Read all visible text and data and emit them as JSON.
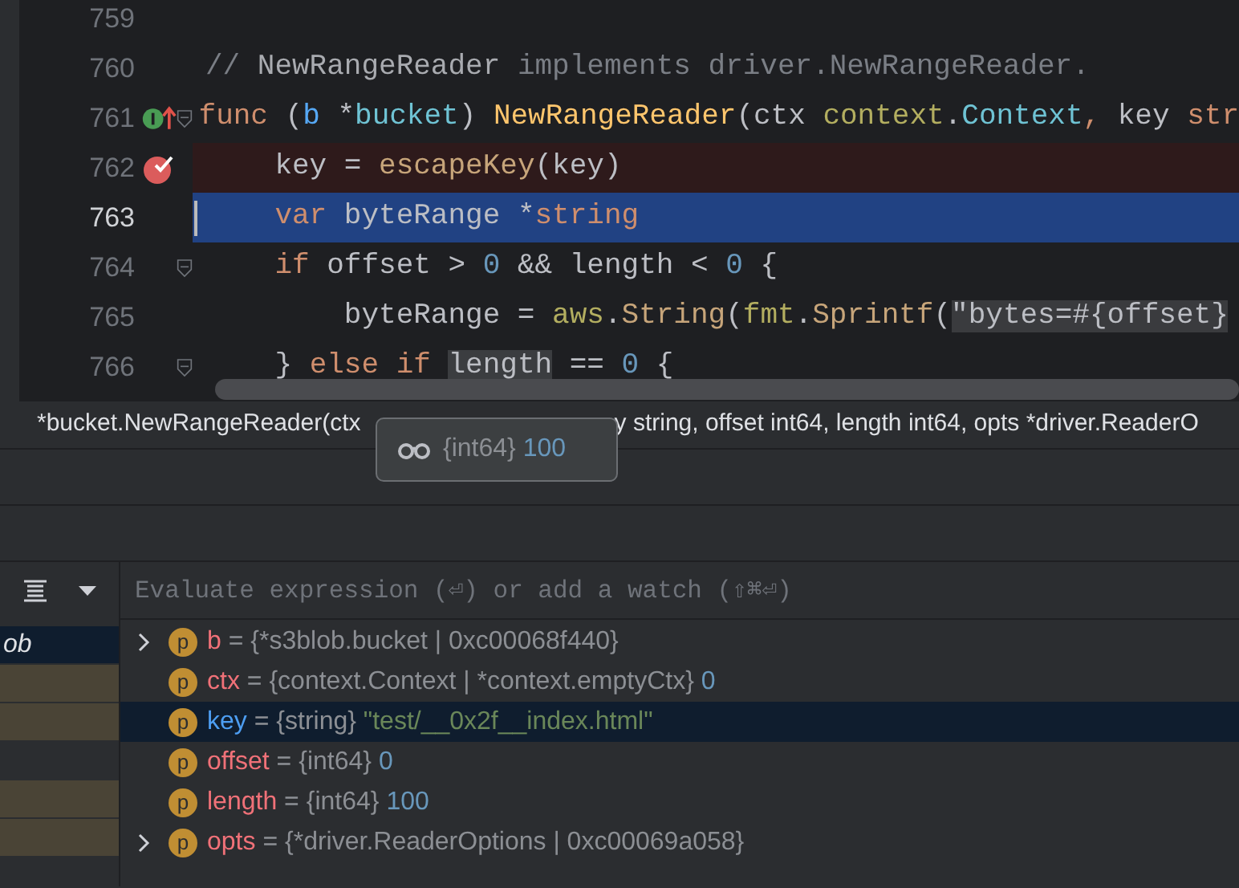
{
  "editor": {
    "lines": [
      {
        "number": "759",
        "breakpoint": false,
        "current": false,
        "implements": false,
        "fold": false
      },
      {
        "number": "760",
        "breakpoint": false,
        "current": false,
        "implements": false,
        "fold": false,
        "tokens": [
          {
            "text": "// ",
            "kind": "comment"
          },
          {
            "text": "NewRangeReader",
            "kind": "comment_ref"
          },
          {
            "text": " implements driver.NewRangeReader.",
            "kind": "comment"
          }
        ]
      },
      {
        "number": "761",
        "breakpoint": false,
        "current": false,
        "implements": true,
        "fold": true,
        "tokens": [
          {
            "text": "func",
            "kind": "kw"
          },
          {
            "text": " (",
            "kind": "plain"
          },
          {
            "text": "b",
            "kind": "param"
          },
          {
            "text": " *",
            "kind": "plain"
          },
          {
            "text": "bucket",
            "kind": "type"
          },
          {
            "text": ") ",
            "kind": "plain"
          },
          {
            "text": "NewRangeReader",
            "kind": "fn"
          },
          {
            "text": "(ctx ",
            "kind": "plain"
          },
          {
            "text": "context",
            "kind": "pkg"
          },
          {
            "text": ".",
            "kind": "plain"
          },
          {
            "text": "Context",
            "kind": "type"
          },
          {
            "text": ", ",
            "kind": "kw"
          },
          {
            "text": "key ",
            "kind": "plain"
          },
          {
            "text": "str",
            "kind": "kw"
          }
        ]
      },
      {
        "number": "762",
        "breakpoint": true,
        "current": false,
        "implements": false,
        "fold": false,
        "tokens": [
          {
            "text": "    key = ",
            "kind": "plain"
          },
          {
            "text": "escapeKey",
            "kind": "call"
          },
          {
            "text": "(key)",
            "kind": "plain"
          }
        ]
      },
      {
        "number": "763",
        "breakpoint": false,
        "current": true,
        "implements": false,
        "fold": false,
        "tokens": [
          {
            "text": "    var",
            "kind": "kw"
          },
          {
            "text": " byteRange *",
            "kind": "plain"
          },
          {
            "text": "string",
            "kind": "kw"
          }
        ]
      },
      {
        "number": "764",
        "breakpoint": false,
        "current": false,
        "implements": false,
        "fold": true,
        "tokens": [
          {
            "text": "    if",
            "kind": "kw"
          },
          {
            "text": " offset > ",
            "kind": "plain"
          },
          {
            "text": "0",
            "kind": "num"
          },
          {
            "text": " && length < ",
            "kind": "plain"
          },
          {
            "text": "0",
            "kind": "num"
          },
          {
            "text": " {",
            "kind": "plain"
          }
        ]
      },
      {
        "number": "765",
        "breakpoint": false,
        "current": false,
        "implements": false,
        "fold": false,
        "tokens": [
          {
            "text": "        byteRange = ",
            "kind": "plain"
          },
          {
            "text": "aws",
            "kind": "pkg"
          },
          {
            "text": ".",
            "kind": "plain"
          },
          {
            "text": "String",
            "kind": "call"
          },
          {
            "text": "(",
            "kind": "plain"
          },
          {
            "text": "fmt",
            "kind": "pkg"
          },
          {
            "text": ".",
            "kind": "plain"
          },
          {
            "text": "Sprintf",
            "kind": "call"
          },
          {
            "text": "(",
            "kind": "plain"
          },
          {
            "text": "\"bytes=#{offset}",
            "kind": "inlay"
          }
        ]
      },
      {
        "number": "766",
        "breakpoint": false,
        "current": false,
        "implements": false,
        "fold": true,
        "tokens": [
          {
            "text": "    } ",
            "kind": "plain"
          },
          {
            "text": "else if ",
            "kind": "kw"
          },
          {
            "text": "length",
            "kind": "hover"
          },
          {
            "text": " == ",
            "kind": "plain"
          },
          {
            "text": "0",
            "kind": "num"
          },
          {
            "text": " {",
            "kind": "plain"
          }
        ]
      }
    ]
  },
  "breadcrumb": {
    "left": "*bucket.NewRangeReader(ctx",
    "right": "y string, offset int64, length int64, opts *driver.ReaderO"
  },
  "tooltip": {
    "type": "{int64}",
    "value": "100"
  },
  "watch_field": {
    "placeholder": "Evaluate expression (⏎) or add a watch (⇧⌘⏎)"
  },
  "frames": [
    {
      "label": "ob",
      "selected": true,
      "library": false
    },
    {
      "selected": false,
      "library": true
    },
    {
      "selected": false,
      "library": true
    },
    {
      "selected": false,
      "library": false
    },
    {
      "selected": false,
      "library": true
    },
    {
      "selected": false,
      "library": true
    }
  ],
  "variables": [
    {
      "badge": "p",
      "name": "b",
      "operator": "=",
      "type": "{*s3blob.bucket | 0xc00068f440}",
      "expandable": true,
      "selected": false
    },
    {
      "badge": "p",
      "name": "ctx",
      "operator": "=",
      "type": "{context.Context | *context.emptyCtx}",
      "value": "0",
      "string_value": false,
      "expandable": false,
      "selected": false
    },
    {
      "badge": "p",
      "name": "key",
      "operator": "=",
      "type": "{string}",
      "value": "\"test/__0x2f__index.html\"",
      "string_value": true,
      "expandable": false,
      "selected": true
    },
    {
      "badge": "p",
      "name": "offset",
      "operator": "=",
      "type": "{int64}",
      "value": "0",
      "string_value": false,
      "expandable": false,
      "selected": false
    },
    {
      "badge": "p",
      "name": "length",
      "operator": "=",
      "type": "{int64}",
      "value": "100",
      "string_value": false,
      "expandable": false,
      "selected": false
    },
    {
      "badge": "p",
      "name": "opts",
      "operator": "=",
      "type": "{*driver.ReaderOptions | 0xc00069a058}",
      "expandable": true,
      "selected": false
    }
  ]
}
